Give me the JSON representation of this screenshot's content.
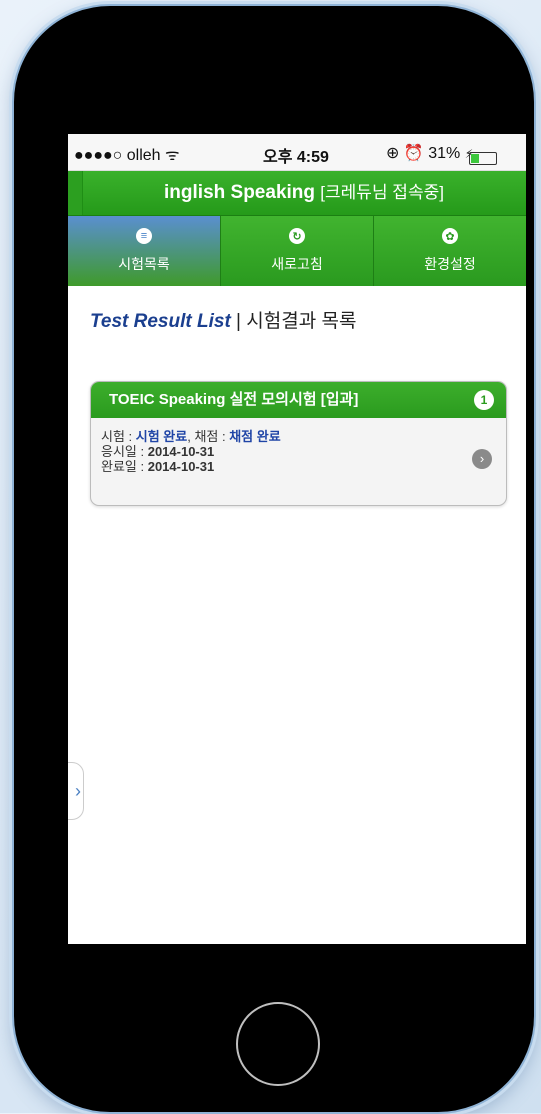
{
  "status_bar": {
    "carrier": "●●●●○ olleh ᯤ",
    "time": "오후 4:59",
    "right": "⊕ ⏰ 31%",
    "battery_fraction": 0.31,
    "charge_glyph": "⚡"
  },
  "app": {
    "title": "inglish Speaking",
    "title_suffix": "[크레듀님 접속중]"
  },
  "tabs": [
    {
      "label": "시험목록",
      "icon": "list-icon",
      "glyph": "≡",
      "active": true
    },
    {
      "label": "새로고침",
      "icon": "refresh-icon",
      "glyph": "↻",
      "active": false
    },
    {
      "label": "환경설정",
      "icon": "gear-icon",
      "glyph": "✿",
      "active": false
    }
  ],
  "page": {
    "heading_en": "Test Result List",
    "heading_sep": " | ",
    "heading_ko": "시험결과 목록"
  },
  "card": {
    "title": "TOEIC Speaking 실전 모의시험 [입과]",
    "count": "1",
    "exam_label": "시험 : ",
    "exam_status": "시험 완료",
    "score_label": ", 채점 : ",
    "score_status": "채점 완료",
    "applied_label": "응시일 : ",
    "applied_date": "2014-10-31",
    "done_label": "완료일 : ",
    "done_date": "2014-10-31",
    "arrow": "›"
  },
  "side_tab": {
    "glyph": "›"
  },
  "colors": {
    "green": "#2a9b1e",
    "blue_text": "#1f44a6",
    "active_tab": "#5a8fd0"
  }
}
